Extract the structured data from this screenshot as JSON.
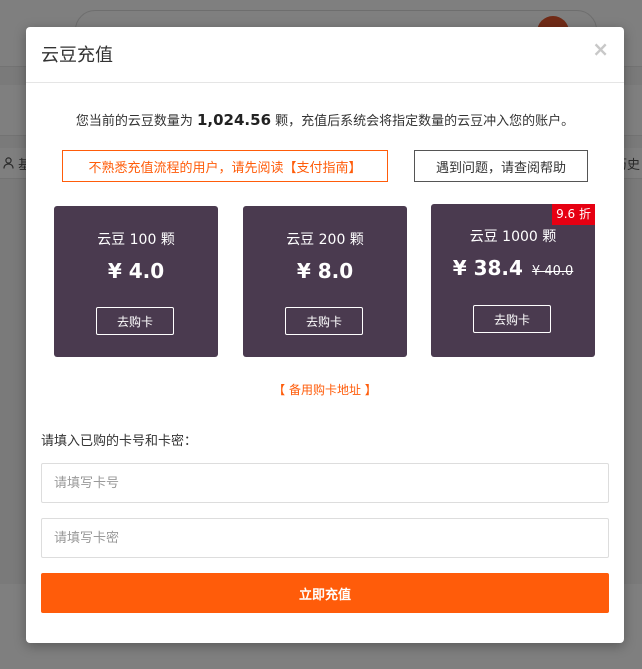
{
  "background": {
    "row_left_text": "基",
    "row_right_text": "历史"
  },
  "modal": {
    "title": "云豆充值",
    "close_label": "×"
  },
  "balance": {
    "prefix": "您当前的云豆数量为",
    "amount": "1,024.56",
    "suffix": "颗，充值后系统会将指定数量的云豆冲入您的账户。"
  },
  "buttons": {
    "guide": "不熟悉充值流程的用户，请先阅读【支付指南】",
    "help": "遇到问题，请查阅帮助"
  },
  "cards": [
    {
      "name": "云豆 100 颗",
      "price": "¥ 4.0",
      "old_price": "",
      "buy_label": "去购卡"
    },
    {
      "name": "云豆 200 颗",
      "price": "¥ 8.0",
      "old_price": "",
      "buy_label": "去购卡"
    },
    {
      "name": "云豆 1000 颗",
      "price": "¥ 38.4",
      "old_price": "¥ 40.0",
      "buy_label": "去购卡",
      "badge": "9.6 折"
    }
  ],
  "backup_link": "【 备用购卡地址 】",
  "form": {
    "label": "请填入已购的卡号和卡密：",
    "card_placeholder": "请填写卡号",
    "pwd_placeholder": "请填写卡密",
    "submit_label": "立即充值"
  },
  "colors": {
    "accent": "#ff5c0a",
    "card_bg": "#4a3a4f",
    "badge_bg": "#e60012"
  }
}
